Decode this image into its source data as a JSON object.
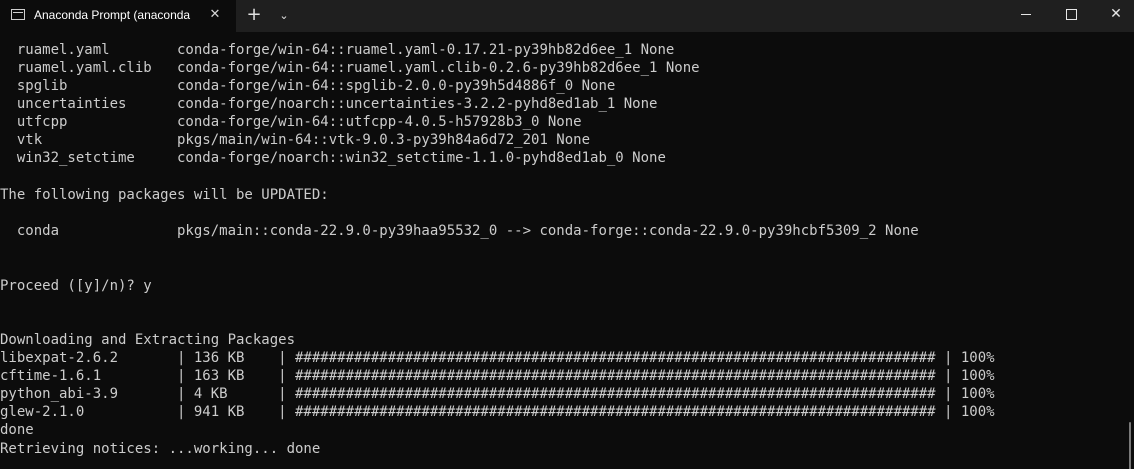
{
  "window": {
    "tab_title": "Anaconda Prompt (anaconda",
    "tab_close": "✕",
    "new_tab": "+",
    "dropdown": "⌄",
    "close": "✕"
  },
  "terminal": {
    "lines": [
      "  ruamel.yaml        conda-forge/win-64::ruamel.yaml-0.17.21-py39hb82d6ee_1 None",
      "  ruamel.yaml.clib   conda-forge/win-64::ruamel.yaml.clib-0.2.6-py39hb82d6ee_1 None",
      "  spglib             conda-forge/win-64::spglib-2.0.0-py39h5d4886f_0 None",
      "  uncertainties      conda-forge/noarch::uncertainties-3.2.2-pyhd8ed1ab_1 None",
      "  utfcpp             conda-forge/win-64::utfcpp-4.0.5-h57928b3_0 None",
      "  vtk                pkgs/main/win-64::vtk-9.0.3-py39h84a6d72_201 None",
      "  win32_setctime     conda-forge/noarch::win32_setctime-1.1.0-pyhd8ed1ab_0 None",
      "",
      "The following packages will be UPDATED:",
      "",
      "  conda              pkgs/main::conda-22.9.0-py39haa95532_0 --> conda-forge::conda-22.9.0-py39hcbf5309_2 None",
      "",
      "",
      "Proceed ([y]/n)? y",
      "",
      "",
      "Downloading and Extracting Packages",
      "libexpat-2.6.2       | 136 KB    | ############################################################################ | 100%",
      "cftime-1.6.1         | 163 KB    | ############################################################################ | 100%",
      "python_abi-3.9       | 4 KB      | ############################################################################ | 100%",
      "glew-2.1.0           | 941 KB    | ############################################################################ | 100%",
      "done",
      "Retrieving notices: ...working... done"
    ]
  }
}
